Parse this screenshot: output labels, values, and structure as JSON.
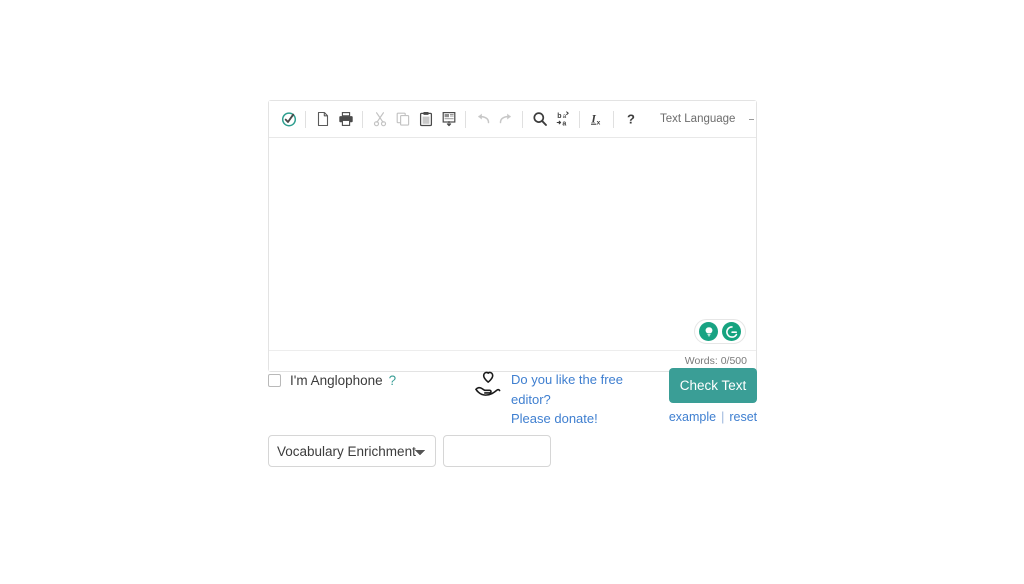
{
  "editor": {
    "toolbar": {
      "buttons": [
        {
          "name": "spellcheck-icon",
          "label": "Check spelling",
          "disabled": false
        },
        {
          "name": "new-document-icon",
          "label": "New document",
          "disabled": false
        },
        {
          "name": "print-icon",
          "label": "Print",
          "disabled": false
        },
        {
          "name": "cut-icon",
          "label": "Cut",
          "disabled": true
        },
        {
          "name": "copy-icon",
          "label": "Copy",
          "disabled": true
        },
        {
          "name": "paste-icon",
          "label": "Paste",
          "disabled": false
        },
        {
          "name": "paste-from-word-icon",
          "label": "Paste from Word",
          "disabled": false
        },
        {
          "name": "undo-icon",
          "label": "Undo",
          "disabled": true
        },
        {
          "name": "redo-icon",
          "label": "Redo",
          "disabled": true
        },
        {
          "name": "find-icon",
          "label": "Find",
          "disabled": false
        },
        {
          "name": "replace-icon",
          "label": "Replace",
          "disabled": false
        },
        {
          "name": "remove-format-icon",
          "label": "Remove Format",
          "disabled": false
        },
        {
          "name": "help-icon",
          "label": "About",
          "disabled": false
        }
      ],
      "language_label": "Text Language"
    },
    "content": "",
    "placeholder": "",
    "assist": {
      "bulb_label": "Writing suggestions",
      "grammar_label": "Grammarly"
    },
    "footer": {
      "words_label": "Words: 0/500"
    }
  },
  "actions": {
    "anglophone_label": "I'm Anglophone",
    "anglophone_help": "?",
    "anglophone_checked": false,
    "donate": {
      "line1": "Do you like the free",
      "line2": "editor?",
      "line3": "Please donate!"
    },
    "check_button_label": "Check Text",
    "example_link": "example",
    "separator": "|",
    "reset_link": "reset"
  },
  "tools": {
    "vocab_selected": "Vocabulary Enrichment",
    "vocab_options": [
      "Vocabulary Enrichment"
    ],
    "vocab_input_value": "",
    "vocab_input_placeholder": ""
  },
  "colors": {
    "accent_teal": "#3a9e96",
    "link_blue": "#3f7fd0",
    "pill_green": "#15a37f",
    "border_gray": "#e3e3e3"
  }
}
